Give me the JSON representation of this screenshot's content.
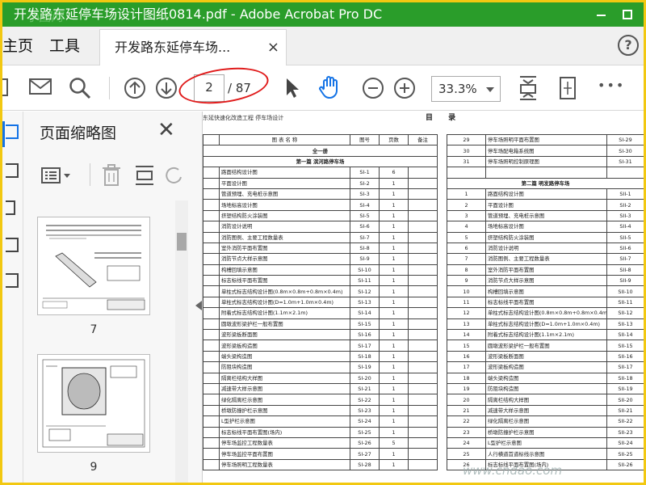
{
  "window": {
    "title": "开发路东延停车场设计图纸0814.pdf - Adobe Acrobat Pro DC"
  },
  "watermark_logo": "小图网",
  "nav": {
    "home": "主页",
    "tools": "工具"
  },
  "tab": {
    "label": "开发路东延停车场...",
    "close": "×"
  },
  "help": "?",
  "toolbar": {
    "page_current": "2",
    "page_total": "/ 87",
    "zoom": "33.3%",
    "more": "•••",
    "icons": [
      "save-icon",
      "email-icon",
      "search-icon",
      "page-up-icon",
      "page-down-icon",
      "select-arrow-icon",
      "hand-icon",
      "zoom-out-icon",
      "zoom-in-icon",
      "fit-page-icon",
      "scroll-mode-icon",
      "more-icon"
    ]
  },
  "accent": "#1473e6",
  "panel": {
    "title": "页面缩略图",
    "thumbnails": [
      {
        "label": "7"
      },
      {
        "label": "9"
      }
    ]
  },
  "doc": {
    "header": "东延快速化改造工程  停车场设计",
    "title": "目  录",
    "left_columns": [
      "图  表  名  称",
      "图号",
      "页数",
      "备注"
    ],
    "left_sections": [
      "全一册",
      "第一篇  滨河路停车场"
    ],
    "left_rows": [
      [
        "路面结构设计图",
        "SI-1",
        "6"
      ],
      [
        "平面设计图",
        "SI-2",
        "1"
      ],
      [
        "管道预埋、充电桩示意图",
        "SI-3",
        "1"
      ],
      [
        "场地标高设计图",
        "SI-4",
        "1"
      ],
      [
        "挤塑结构防火涂装图",
        "SI-5",
        "1"
      ],
      [
        "消防设计说明",
        "SI-6",
        "1"
      ],
      [
        "消防图例、主要工程数量表",
        "SI-7",
        "1"
      ],
      [
        "室外消防平面布置图",
        "SI-8",
        "1"
      ],
      [
        "消防节点大样示意图",
        "SI-9",
        "1"
      ],
      [
        "构槽回填示意图",
        "SI-10",
        "1"
      ],
      [
        "标志标线平面布置图",
        "SI-11",
        "1"
      ],
      [
        "单柱式标志结构设计图(0.8m×0.8m+0.8m×0.4m)",
        "SI-12",
        "1"
      ],
      [
        "单柱式标志结构设计图(D=1.0m+1.0m×0.4m)",
        "SI-13",
        "1"
      ],
      [
        "附着式标志结构设计图(1.1m×2.1m)",
        "SI-14",
        "1"
      ],
      [
        "圆墩波形梁护栏一般布置图",
        "SI-15",
        "1"
      ],
      [
        "波形梁板断面图",
        "SI-16",
        "1"
      ],
      [
        "波形梁板构造图",
        "SI-17",
        "1"
      ],
      [
        "端头梁构造图",
        "SI-18",
        "1"
      ],
      [
        "防阻块构造图",
        "SI-19",
        "1"
      ],
      [
        "隔离栏结构大样图",
        "SI-20",
        "1"
      ],
      [
        "减速带大样示意图",
        "SI-21",
        "1"
      ],
      [
        "绿化隔离栏示意图",
        "SI-22",
        "1"
      ],
      [
        "桥墩防撞护栏示意图",
        "SI-23",
        "1"
      ],
      [
        "L型护栏示意图",
        "SI-24",
        "1"
      ],
      [
        "标志标线平面布置图(场内)",
        "SI-25",
        "1"
      ],
      [
        "停车场监控工程数量表",
        "SI-26",
        "5"
      ],
      [
        "停车场监控平面布置图",
        "SI-27",
        "1"
      ],
      [
        "停车场照明工程数量表",
        "SI-28",
        "1"
      ]
    ],
    "right_rows_top": [
      [
        "29",
        "停车场照明平面布置图",
        "SI-29"
      ],
      [
        "30",
        "停车场配电箱系统图",
        "SI-30"
      ],
      [
        "31",
        "停车场照明控制原理图",
        "SI-31"
      ]
    ],
    "right_section": "第二篇  明发路停车场",
    "right_rows": [
      [
        "1",
        "路面结构设计图",
        "SII-1"
      ],
      [
        "2",
        "平面设计图",
        "SII-2"
      ],
      [
        "3",
        "管道预埋、充电桩示意图",
        "SII-3"
      ],
      [
        "4",
        "场地标高设计图",
        "SII-4"
      ],
      [
        "5",
        "挤塑结构防火涂装图",
        "SII-5"
      ],
      [
        "6",
        "消防设计说明",
        "SII-6"
      ],
      [
        "7",
        "消防图例、主要工程数量表",
        "SII-7"
      ],
      [
        "8",
        "室外消防平面布置图",
        "SII-8"
      ],
      [
        "9",
        "消防节点大样示意图",
        "SII-9"
      ],
      [
        "10",
        "构槽回填示意图",
        "SII-10"
      ],
      [
        "11",
        "标志标线平面布置图",
        "SII-11"
      ],
      [
        "12",
        "单柱式标志结构设计图(0.8m×0.8m+0.8m×0.4m)",
        "SII-12"
      ],
      [
        "13",
        "单柱式标志结构设计图(D=1.0m+1.0m×0.4m)",
        "SII-13"
      ],
      [
        "14",
        "附着式标志结构设计图(1.1m×2.1m)",
        "SII-14"
      ],
      [
        "15",
        "圆墩波形梁护栏一般布置图",
        "SII-15"
      ],
      [
        "16",
        "波形梁板断面图",
        "SII-16"
      ],
      [
        "17",
        "波形梁板构造图",
        "SII-17"
      ],
      [
        "18",
        "端头梁构造图",
        "SII-18"
      ],
      [
        "19",
        "防阻块构造图",
        "SII-19"
      ],
      [
        "20",
        "隔离栏结构大样图",
        "SII-20"
      ],
      [
        "21",
        "减速带大样示意图",
        "SII-21"
      ],
      [
        "22",
        "绿化隔离栏示意图",
        "SII-22"
      ],
      [
        "23",
        "桥墩防撞护栏示意图",
        "SII-23"
      ],
      [
        "24",
        "L型护栏示意图",
        "SII-24"
      ],
      [
        "25",
        "人行横道首道标线示意图",
        "SII-25"
      ],
      [
        "26",
        "标志标线平面布置图(场内)",
        "SII-26"
      ]
    ]
  },
  "site_watermark": "www.cndao.com"
}
